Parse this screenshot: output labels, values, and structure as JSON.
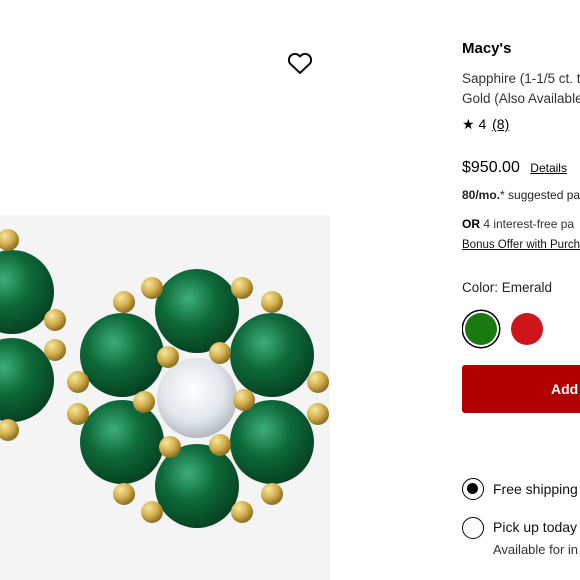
{
  "product": {
    "brand": "Macy's",
    "title_line1": "Sapphire (1-1/5 ct. t",
    "title_line2": "Gold (Also Available",
    "rating_star": "★",
    "rating_value": "4",
    "rating_count": "(8)",
    "price": "$950.00",
    "details_link": "Details",
    "monthly_amount": "80/mo.",
    "monthly_rest": "* suggested pa",
    "interest_or": "OR",
    "interest_text": " 4 interest-free pa",
    "bonus_offer": "Bonus Offer with Purch",
    "color_label": "Color: Emerald",
    "swatches": [
      {
        "name": "Emerald",
        "color": "#1a7a10",
        "selected": true
      },
      {
        "name": "Ruby",
        "color": "#d0141c",
        "selected": false
      }
    ],
    "add_button": "Add",
    "shipping_options": [
      {
        "label": "Free shipping",
        "checked": true
      },
      {
        "label": "Pick up today",
        "sub": "Available for in",
        "checked": false
      }
    ]
  },
  "colors": {
    "accent": "#b00000",
    "gem": "#0e6b3a",
    "gold": "#d4b04e"
  }
}
